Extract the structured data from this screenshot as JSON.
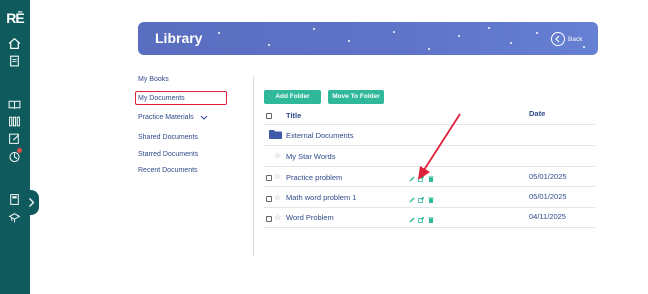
{
  "app": {
    "logo_text": "RĒ"
  },
  "rail": {
    "icons": [
      "home-icon",
      "clipboard-icon",
      "book-open-icon",
      "library-icon",
      "edit-icon",
      "analytics-icon",
      "calculator-icon",
      "teacher-icon"
    ]
  },
  "banner": {
    "title": "Library",
    "back_label": "Back"
  },
  "nav": {
    "items": [
      {
        "label": "My Books"
      },
      {
        "label": "My Documents"
      },
      {
        "label": "Practice Materials"
      },
      {
        "label": "Shared Documents"
      },
      {
        "label": "Starred Documents"
      },
      {
        "label": "Recent Documents"
      }
    ]
  },
  "toolbar": {
    "add_folder": "Add Folder",
    "move_to_folder": "Move To Folder"
  },
  "table": {
    "headers": {
      "title": "Title",
      "date": "Date"
    },
    "rows": [
      {
        "title": "External Documents",
        "date": ""
      },
      {
        "title": "My Star Words",
        "date": ""
      },
      {
        "title": "Practice problem",
        "date": "05/01/2025"
      },
      {
        "title": "Math word problem 1",
        "date": "05/01/2025"
      },
      {
        "title": "Word Problem",
        "date": "04/11/2025"
      }
    ]
  },
  "colors": {
    "rail": "#0e5a5c",
    "banner": "#5e73c7",
    "accent_green": "#2fb99a",
    "text_blue": "#2f4a8a",
    "highlight_red": "#e0203a"
  }
}
